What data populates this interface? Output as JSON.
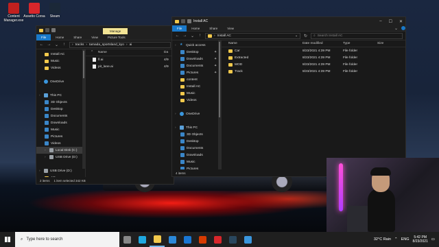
{
  "desktop": {
    "icons": [
      {
        "label": "Content Manager.exe",
        "color": "#c0201f"
      },
      {
        "label": "Assetto Corsa",
        "color": "#d8262b"
      },
      {
        "label": "Steam",
        "color": "#1b2838"
      }
    ]
  },
  "win1": {
    "ribbon": [
      "File",
      "Home",
      "Share",
      "View"
    ],
    "context_tab": "Manage",
    "context_sub": "Picture Tools",
    "address": [
      "tracks",
      "tamada_sportsland_kyo",
      "ai"
    ],
    "nav": [
      {
        "label": "Install AC",
        "type": "folder"
      },
      {
        "label": "Music",
        "type": "folder"
      },
      {
        "label": "Videos",
        "type": "folder"
      },
      {
        "label": "",
        "type": "spacer"
      },
      {
        "label": "OneDrive",
        "type": "cloud"
      },
      {
        "label": "",
        "type": "spacer"
      },
      {
        "label": "This PC",
        "type": "pc"
      },
      {
        "label": "3D Objects",
        "type": "blue"
      },
      {
        "label": "Desktop",
        "type": "blue"
      },
      {
        "label": "Documents",
        "type": "blue"
      },
      {
        "label": "Downloads",
        "type": "blue"
      },
      {
        "label": "Music",
        "type": "blue"
      },
      {
        "label": "Pictures",
        "type": "blue"
      },
      {
        "label": "Videos",
        "type": "blue"
      },
      {
        "label": "Local Disk (C:)",
        "type": "disk",
        "selected": true
      },
      {
        "label": "USB Drive (D:)",
        "type": "disk"
      },
      {
        "label": "",
        "type": "spacer"
      },
      {
        "label": "USB Drive (D:)",
        "type": "disk"
      },
      {
        "label": "AC",
        "type": "folder"
      },
      {
        "label": "Windows",
        "type": "folder"
      }
    ],
    "col_name": "Name",
    "col_date": "Da",
    "files": [
      {
        "name": "fl.ai",
        "date": "4/9"
      },
      {
        "name": "pit_lane.ai",
        "date": "4/9"
      }
    ],
    "status": [
      "2 items",
      "1 item selected 342 KB"
    ]
  },
  "win2": {
    "title": "Install AC",
    "ribbon": [
      "File",
      "Home",
      "Share",
      "View"
    ],
    "address": [
      "Install AC"
    ],
    "search_placeholder": "Search Install AC",
    "nav": [
      {
        "label": "Quick access",
        "type": "star"
      },
      {
        "label": "Desktop",
        "type": "blue",
        "pin": true
      },
      {
        "label": "Downloads",
        "type": "blue",
        "pin": true
      },
      {
        "label": "Documents",
        "type": "blue",
        "pin": true
      },
      {
        "label": "Pictures",
        "type": "blue",
        "pin": true
      },
      {
        "label": "content",
        "type": "folder"
      },
      {
        "label": "Install AC",
        "type": "folder"
      },
      {
        "label": "Music",
        "type": "folder"
      },
      {
        "label": "Videos",
        "type": "folder"
      },
      {
        "label": "",
        "type": "spacer"
      },
      {
        "label": "OneDrive",
        "type": "cloud"
      },
      {
        "label": "",
        "type": "spacer"
      },
      {
        "label": "This PC",
        "type": "pc"
      },
      {
        "label": "3D Objects",
        "type": "blue"
      },
      {
        "label": "Desktop",
        "type": "blue"
      },
      {
        "label": "Documents",
        "type": "blue"
      },
      {
        "label": "Downloads",
        "type": "blue"
      },
      {
        "label": "Music",
        "type": "blue"
      },
      {
        "label": "Pictures",
        "type": "blue"
      }
    ],
    "columns": [
      "Name",
      "Date modified",
      "Type",
      "Size"
    ],
    "rows": [
      {
        "name": "Car",
        "date": "8/23/2021 4:39 PM",
        "type": "File folder"
      },
      {
        "name": "Extracted",
        "date": "8/23/2021 4:39 PM",
        "type": "File folder"
      },
      {
        "name": "MOD",
        "date": "8/23/2021 4:39 PM",
        "type": "File folder"
      },
      {
        "name": "Track",
        "date": "8/23/2021 4:39 PM",
        "type": "File folder"
      }
    ],
    "status": "4 items"
  },
  "taskbar": {
    "search_placeholder": "Type here to search",
    "apps": [
      {
        "name": "task-view",
        "color": "#888888"
      },
      {
        "name": "edge",
        "color": "#1fa8e0"
      },
      {
        "name": "file-explorer",
        "color": "#f2c94c"
      },
      {
        "name": "store",
        "color": "#2b88d8"
      },
      {
        "name": "mail",
        "color": "#1976d2"
      },
      {
        "name": "office",
        "color": "#d83b01"
      },
      {
        "name": "assetto-corsa",
        "color": "#d8262b"
      },
      {
        "name": "steam",
        "color": "#2a475e"
      },
      {
        "name": "photos",
        "color": "#3a96dd"
      }
    ],
    "weather": "32°C  Rain",
    "lang": "ENG",
    "time": "5:42 PM",
    "date": "8/23/2021"
  }
}
